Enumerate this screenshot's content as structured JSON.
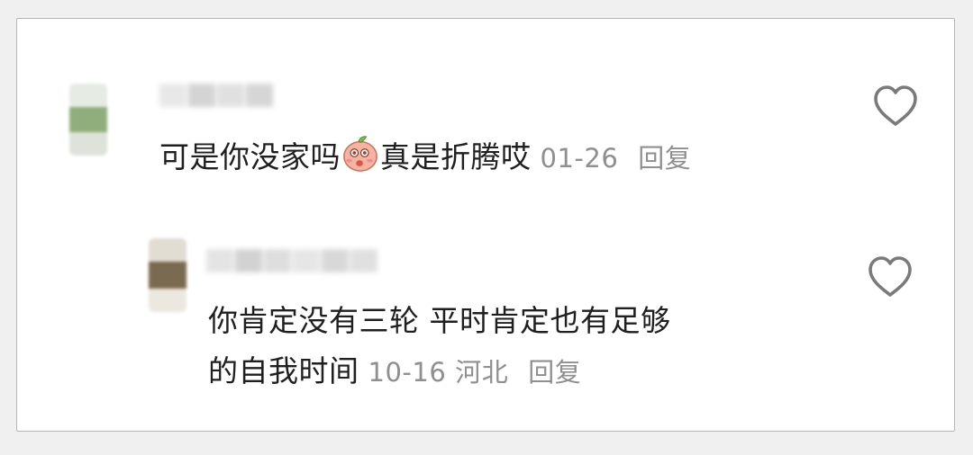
{
  "comments": [
    {
      "text_before_emoji": "可是你没家吗",
      "emoji": "peach-face-emoji",
      "text_after_emoji": "真是折腾哎",
      "date": "01-26",
      "reply_label": "回复"
    },
    {
      "line1": "你肯定没有三轮  平时肯定也有足够",
      "line2": "的自我时间",
      "date": "10-16",
      "location": "河北",
      "reply_label": "回复"
    }
  ],
  "colors": {
    "text": "#1f1f1f",
    "meta": "#8f8f8f",
    "icon": "#7a7a7a",
    "border": "#b5b5b5"
  }
}
